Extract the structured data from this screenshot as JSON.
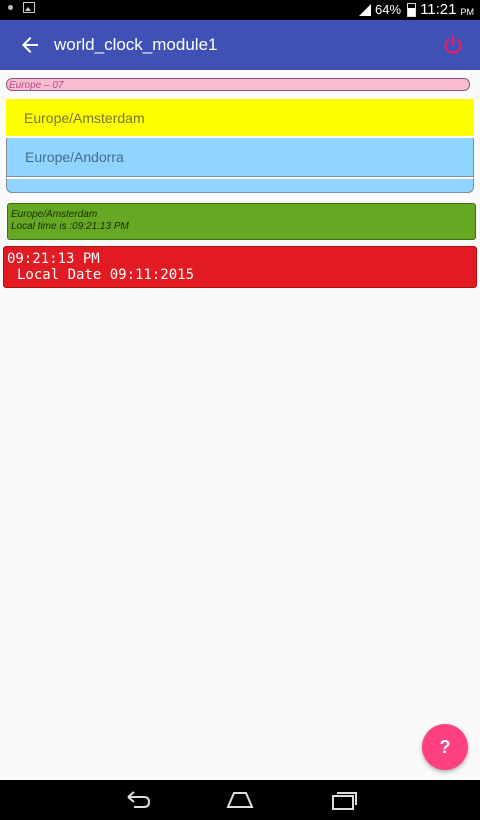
{
  "status_bar": {
    "battery": "64%",
    "time": "11:21",
    "ampm": "PM",
    "icons": [
      "notification-dot-icon",
      "image-icon",
      "signal-icon",
      "battery-icon"
    ]
  },
  "toolbar": {
    "title": "world_clock_module1",
    "back_icon": "arrow-left-icon",
    "power_icon": "power-icon",
    "background": "#3f51b5",
    "power_color": "#e91e63"
  },
  "zone_header": "Europe – 07",
  "zones": [
    {
      "label": "Europe/Amsterdam",
      "color": "#ffff00"
    },
    {
      "label": "Europe/Andorra",
      "color": "#90d5ff"
    }
  ],
  "info": {
    "zone": "Europe/Amsterdam",
    "local_time": "Local time is :09:21:13 PM"
  },
  "clock": {
    "time": "09:21:13 PM",
    "date": "Local Date 09:11:2015"
  },
  "fab": {
    "label": "?",
    "color": "#ff4081"
  },
  "nav": {
    "icons": [
      "back-nav-icon",
      "home-nav-icon",
      "recent-apps-icon"
    ]
  }
}
